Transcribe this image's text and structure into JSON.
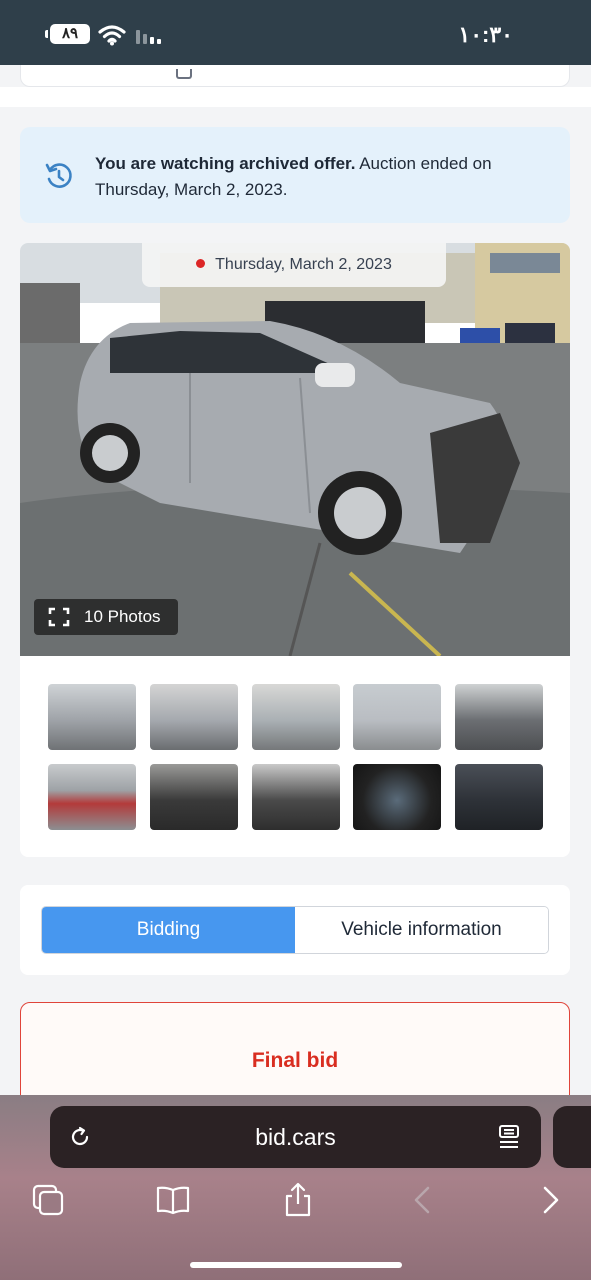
{
  "status_bar": {
    "time": "١٠:٣٠",
    "battery": "٨٩"
  },
  "notice": {
    "bold": "You are watching archived offer.",
    "text": " Auction ended on Thursday, March 2, 2023."
  },
  "gallery": {
    "date": "Thursday, March 2, 2023",
    "photos_label": "10 Photos"
  },
  "tabs": [
    {
      "label": "Bidding",
      "active": true
    },
    {
      "label": "Vehicle information",
      "active": false
    }
  ],
  "final_bid": {
    "label": "Final bid"
  },
  "browser": {
    "url": "bid.cars"
  },
  "colors": {
    "accent": "#4797ef",
    "notice_bg": "#e4f1fb",
    "final_red": "#d92d20",
    "status_bar": "#2f3f4a"
  }
}
